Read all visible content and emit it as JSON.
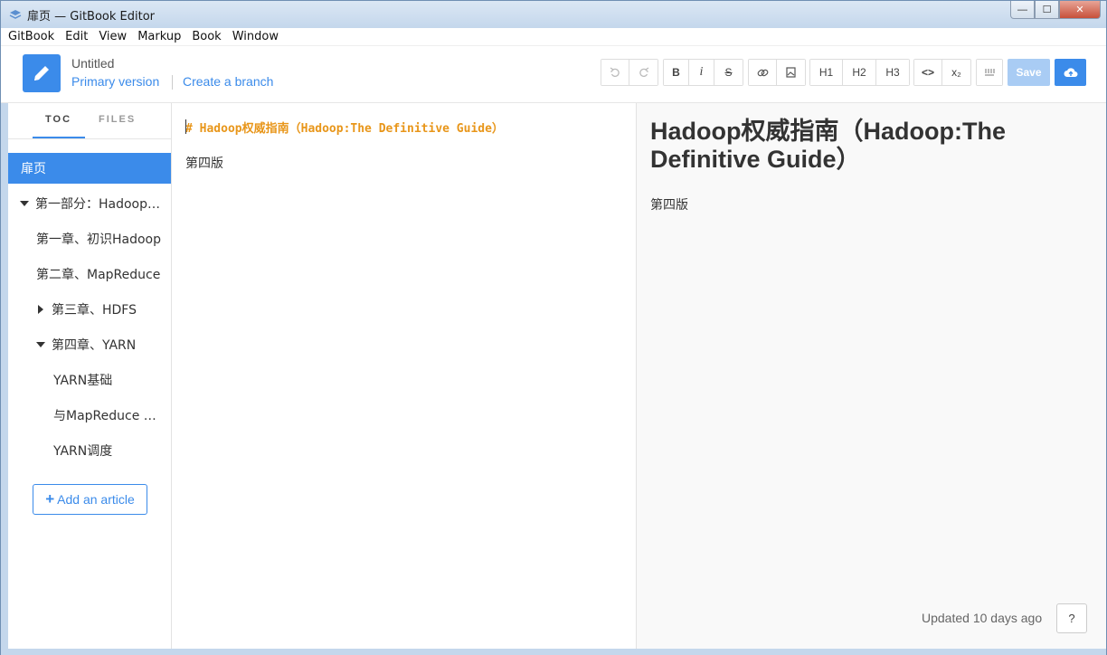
{
  "window": {
    "title": "扉页 — GitBook Editor",
    "controls": {
      "minimize": "—",
      "maximize": "☐",
      "close": "✕"
    }
  },
  "menu": [
    "GitBook",
    "Edit",
    "View",
    "Markup",
    "Book",
    "Window"
  ],
  "header": {
    "book_title": "Untitled",
    "version_label": "Primary version",
    "branch_label": "Create a branch",
    "toolbar": {
      "bold": "B",
      "italic": "i",
      "strike": "S",
      "h1": "H1",
      "h2": "H2",
      "h3": "H3",
      "code": "<>",
      "subscript": "x₂",
      "save": "Save"
    },
    "accent_color": "#3b8bea"
  },
  "sidebar": {
    "tabs": [
      "TOC",
      "FILES"
    ],
    "active_tab": "TOC",
    "items": [
      {
        "label": "扉页",
        "active": true,
        "level": 0,
        "caret": "none"
      },
      {
        "label": "第一部分：Hadoop…",
        "active": false,
        "level": 0,
        "caret": "down"
      },
      {
        "label": "第一章、初识Hadoop",
        "active": false,
        "level": 1,
        "caret": "none"
      },
      {
        "label": "第二章、MapReduce",
        "active": false,
        "level": 1,
        "caret": "none"
      },
      {
        "label": "第三章、HDFS",
        "active": false,
        "level": 1,
        "caret": "right"
      },
      {
        "label": "第四章、YARN",
        "active": false,
        "level": 1,
        "caret": "down"
      },
      {
        "label": "YARN基础",
        "active": false,
        "level": 2,
        "caret": "none"
      },
      {
        "label": "与MapReduce 1…",
        "active": false,
        "level": 2,
        "caret": "none"
      },
      {
        "label": "YARN调度",
        "active": false,
        "level": 2,
        "caret": "none"
      }
    ],
    "add_article": "Add an article"
  },
  "editor": {
    "heading_line": "# Hadoop权威指南（Hadoop:The Definitive Guide）",
    "paragraph": "第四版"
  },
  "preview": {
    "title": "Hadoop权威指南（Hadoop:The Definitive Guide）",
    "paragraph": "第四版",
    "updated": "Updated 10 days ago",
    "help": "?"
  }
}
